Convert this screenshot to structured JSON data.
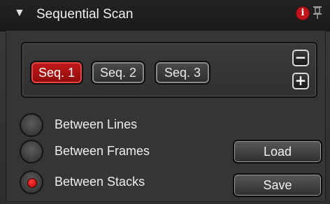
{
  "header": {
    "collapse_icon": "▼",
    "title": "Sequential Scan",
    "info_icon": "i"
  },
  "sequences": {
    "buttons": [
      {
        "label": "Seq. 1",
        "active": true
      },
      {
        "label": "Seq. 2",
        "active": false
      },
      {
        "label": "Seq. 3",
        "active": false
      }
    ],
    "remove_label": "−",
    "add_label": "+"
  },
  "modes": [
    {
      "label": "Between Lines",
      "selected": false
    },
    {
      "label": "Between Frames",
      "selected": false
    },
    {
      "label": "Between Stacks",
      "selected": true
    }
  ],
  "actions": {
    "load_label": "Load",
    "save_label": "Save"
  },
  "colors": {
    "accent": "#c41a1a",
    "background": "#353535"
  }
}
